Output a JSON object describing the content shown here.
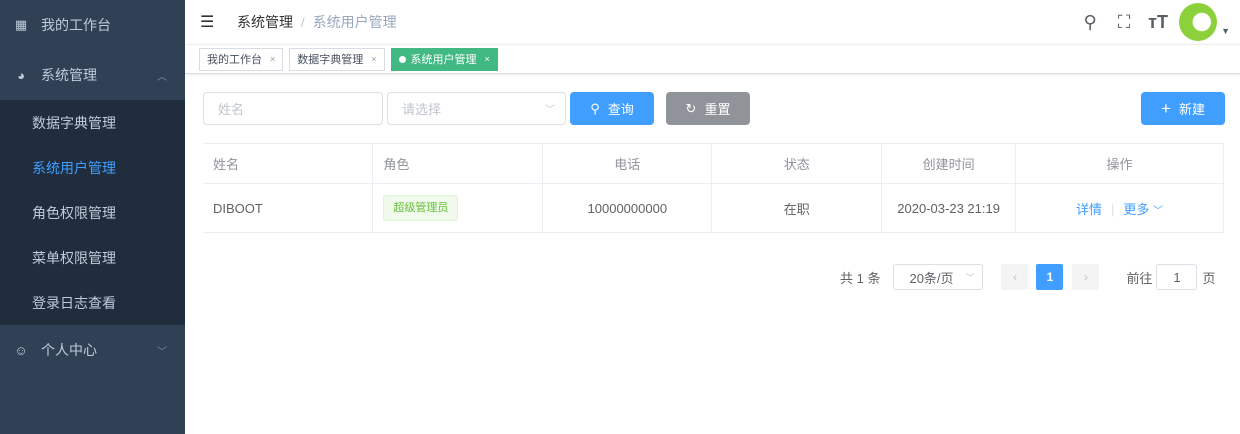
{
  "sidebar": {
    "workbench": "我的工作台",
    "system": "系统管理",
    "sub": [
      "数据字典管理",
      "系统用户管理",
      "角色权限管理",
      "菜单权限管理",
      "登录日志查看"
    ],
    "personal": "个人中心"
  },
  "header": {
    "crumb_parent": "系统管理",
    "crumb_sep": "/",
    "crumb_current": "系统用户管理"
  },
  "tags": [
    {
      "label": "我的工作台"
    },
    {
      "label": "数据字典管理"
    },
    {
      "label": "系统用户管理",
      "active": true
    }
  ],
  "filters": {
    "name_placeholder": "姓名",
    "select_placeholder": "请选择",
    "search": "查询",
    "reset": "重置",
    "create": "新建"
  },
  "table": {
    "headers": [
      "姓名",
      "角色",
      "电话",
      "状态",
      "创建时间",
      "操作"
    ],
    "rows": [
      {
        "name": "DIBOOT",
        "role": "超级管理员",
        "phone": "10000000000",
        "status": "在职",
        "created": "2020-03-23 21:19",
        "detail": "详情",
        "more": "更多"
      }
    ]
  },
  "pagination": {
    "total": "共 1 条",
    "page_size": "20条/页",
    "current": "1",
    "goto": "前往",
    "goto_value": "1",
    "page_unit": "页"
  },
  "colors": {
    "sidebar": "#304156",
    "primary": "#409eff",
    "tag_active": "#42b983"
  }
}
